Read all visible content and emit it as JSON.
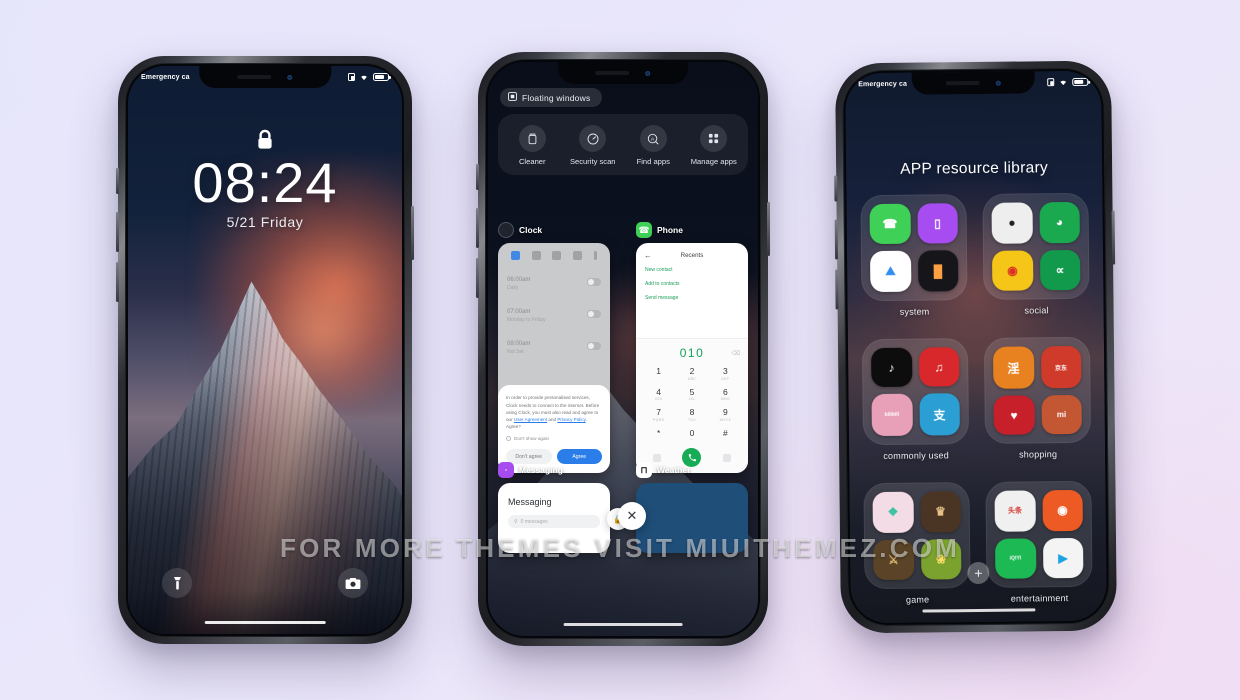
{
  "watermark": "FOR MORE THEMES VISIT MIUITHEMEZ.COM",
  "colors": {
    "accent_blue": "#2b7de9",
    "accent_green": "#16ab54",
    "background": "#e6e5fa"
  },
  "phone_lock": {
    "status_bar": {
      "carrier": "Emergency ca",
      "sim_icon": "sim-icon",
      "wifi_icon": "wifi-icon",
      "battery_icon": "battery-icon"
    },
    "lock_icon": "lock-icon",
    "time": "08:24",
    "date": "5/21  Friday",
    "flashlight_icon": "flashlight-icon",
    "camera_icon": "camera-icon"
  },
  "phone_recents": {
    "floating_windows_chip": {
      "label": "Floating windows",
      "icon": "floating-window-icon"
    },
    "quick_actions": [
      {
        "label": "Cleaner",
        "icon": "trash-icon"
      },
      {
        "label": "Security scan",
        "icon": "speedometer-icon"
      },
      {
        "label": "Find apps",
        "icon": "search-apps-icon"
      },
      {
        "label": "Manage apps",
        "icon": "grid-icon"
      }
    ],
    "cards": [
      {
        "app": "Clock",
        "icon": "clock-icon"
      },
      {
        "app": "Phone",
        "icon": "phone-icon"
      },
      {
        "app": "Messaging",
        "icon": "messaging-icon"
      },
      {
        "app": "Weather",
        "icon": "weather-icon"
      }
    ],
    "clock_card": {
      "alarms": [
        {
          "time": "06:00",
          "meridiem": "am",
          "repeat": "Daily"
        },
        {
          "time": "07:00",
          "meridiem": "am",
          "repeat": "Monday to Friday"
        },
        {
          "time": "08:00",
          "meridiem": "am",
          "repeat": "Not Set"
        }
      ],
      "dialog": {
        "body_1": "In order to provide personalised services, Clock needs to connect to the internet. Before using Clock, you must also read and agree to our ",
        "link_1": "User Agreement",
        "body_2": " and ",
        "link_2": "Privacy Policy",
        "body_3": ". Agree?",
        "checkbox_label": "Don't show again",
        "decline_label": "Don't agree",
        "accept_label": "Agree"
      }
    },
    "phone_card": {
      "back_icon": "back-arrow-icon",
      "title": "Recents",
      "links": [
        "New contact",
        "Add to contacts",
        "Send message"
      ],
      "dialed_number": "010",
      "delete_icon": "backspace-icon",
      "call_icon": "call-icon",
      "keys": [
        {
          "digit": "1",
          "letters": ""
        },
        {
          "digit": "2",
          "letters": "ABC"
        },
        {
          "digit": "3",
          "letters": "DEF"
        },
        {
          "digit": "4",
          "letters": "GHI"
        },
        {
          "digit": "5",
          "letters": "JKL"
        },
        {
          "digit": "6",
          "letters": "MNO"
        },
        {
          "digit": "7",
          "letters": "PQRS"
        },
        {
          "digit": "8",
          "letters": "TUV"
        },
        {
          "digit": "9",
          "letters": "WXYZ"
        },
        {
          "digit": "*",
          "letters": ""
        },
        {
          "digit": "0",
          "letters": "+"
        },
        {
          "digit": "#",
          "letters": ""
        }
      ]
    },
    "messaging_card": {
      "title": "Messaging",
      "search_placeholder": "0 messages",
      "search_icon": "search-icon"
    },
    "close_icon": "close-icon",
    "lock_card_icon": "lock-card-icon"
  },
  "phone_library": {
    "status_bar": {
      "carrier": "Emergency ca",
      "sim_icon": "sim-icon",
      "wifi_icon": "wifi-icon",
      "battery_icon": "battery-icon"
    },
    "title": "APP resource library",
    "add_icon": "add-icon",
    "folders": [
      {
        "label": "system",
        "apps": [
          {
            "name": "phone-app-icon",
            "glyph": "✆",
            "bg": "#3fd157",
            "fg": "#ffffff"
          },
          {
            "name": "messaging-app-icon",
            "glyph": "▭",
            "bg": "#a74cf0",
            "fg": "#ffffff"
          },
          {
            "name": "gallery-app-icon",
            "glyph": "⛰",
            "bg": "#ffffff",
            "fg": "#2f8ef0"
          },
          {
            "name": "themes-app-icon",
            "glyph": "▬",
            "bg": "#16161a",
            "fg": "#ffffff"
          }
        ]
      },
      {
        "label": "social",
        "apps": [
          {
            "name": "qq-app-icon",
            "glyph": "●",
            "bg": "#eeeeee",
            "fg": "#1f1f1f"
          },
          {
            "name": "wechat-app-icon",
            "glyph": "◕",
            "bg": "#1aa94f",
            "fg": "#ffffff"
          },
          {
            "name": "weibo-app-icon",
            "glyph": "◉",
            "bg": "#f5c518",
            "fg": "#d93025"
          },
          {
            "name": "alipay-social-app-icon",
            "glyph": "∝",
            "bg": "#129a4c",
            "fg": "#ffffff"
          }
        ]
      },
      {
        "label": "commonly used",
        "apps": [
          {
            "name": "tiktok-app-icon",
            "glyph": "♪",
            "bg": "#0d0d0d",
            "fg": "#ffffff"
          },
          {
            "name": "netease-music-app-icon",
            "glyph": "♫",
            "bg": "#d8282c",
            "fg": "#ffffff"
          },
          {
            "name": "bilibili-app-icon",
            "glyph": "bilibili",
            "bg": "#e8a0b8",
            "fg": "#ffffff"
          },
          {
            "name": "alipay-app-icon",
            "glyph": "支",
            "bg": "#2b9fd4",
            "fg": "#ffffff"
          }
        ]
      },
      {
        "label": "shopping",
        "apps": [
          {
            "name": "taobao-app-icon",
            "glyph": "淘",
            "bg": "#e8811f",
            "fg": "#ffffff"
          },
          {
            "name": "jd-app-icon",
            "glyph": "京东",
            "bg": "#cf3a2a",
            "fg": "#ffffff"
          },
          {
            "name": "meituan-app-icon",
            "glyph": "♥",
            "bg": "#c8202a",
            "fg": "#ffffff"
          },
          {
            "name": "mi-store-app-icon",
            "glyph": "mi",
            "bg": "#c35633",
            "fg": "#ffffff"
          }
        ]
      },
      {
        "label": "game",
        "apps": [
          {
            "name": "game-center-app-icon",
            "glyph": "❖",
            "bg": "#f4dce6",
            "fg": "#3cc2a0"
          },
          {
            "name": "honor-of-kings-app-icon",
            "glyph": "♛",
            "bg": "#4a3524",
            "fg": "#e6c288"
          },
          {
            "name": "strategy-game-app-icon",
            "glyph": "⚔",
            "bg": "#5a4326",
            "fg": "#e0b874"
          },
          {
            "name": "puzzle-game-app-icon",
            "glyph": "❀",
            "bg": "#7ba22e",
            "fg": "#ffe066"
          }
        ]
      },
      {
        "label": "entertainment",
        "apps": [
          {
            "name": "toutiao-app-icon",
            "glyph": "头条",
            "bg": "#f0f0f0",
            "fg": "#d2332d"
          },
          {
            "name": "kuaishou-app-icon",
            "glyph": "◉",
            "bg": "#ee5a24",
            "fg": "#ffffff"
          },
          {
            "name": "iqiyi-app-icon",
            "glyph": "iQIYI",
            "bg": "#1db954",
            "fg": "#ffffff"
          },
          {
            "name": "tencent-video-app-icon",
            "glyph": "▶",
            "bg": "#f4f4f4",
            "fg": "#1ba3e0"
          }
        ]
      }
    ]
  }
}
